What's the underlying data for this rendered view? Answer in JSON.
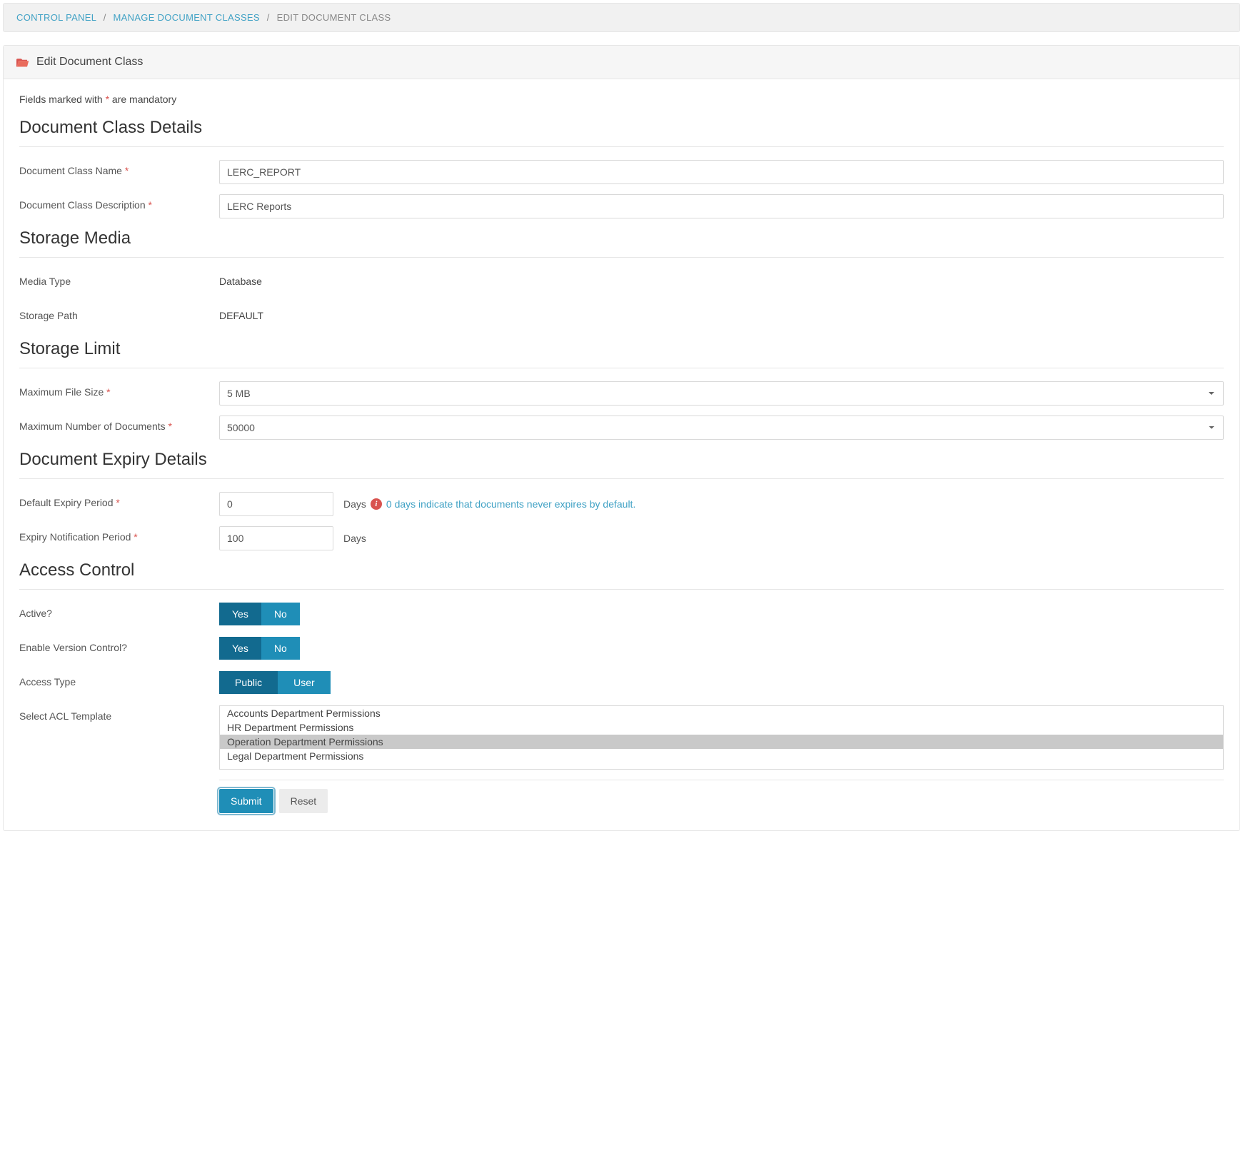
{
  "breadcrumb": {
    "items": [
      {
        "label": "CONTROL PANEL"
      },
      {
        "label": "MANAGE DOCUMENT CLASSES"
      }
    ],
    "current": "EDIT DOCUMENT CLASS"
  },
  "panel": {
    "title": "Edit Document Class"
  },
  "mandatory_note_prefix": "Fields marked with ",
  "mandatory_note_suffix": " are mandatory",
  "asterisk": "*",
  "sections": {
    "details": "Document Class Details",
    "storage_media": "Storage Media",
    "storage_limit": "Storage Limit",
    "expiry": "Document Expiry Details",
    "access": "Access Control"
  },
  "labels": {
    "class_name": "Document Class Name",
    "class_desc": "Document Class Description",
    "media_type": "Media Type",
    "storage_path": "Storage Path",
    "max_file_size": "Maximum File Size",
    "max_docs": "Maximum Number of Documents",
    "default_expiry": "Default Expiry Period",
    "expiry_notif": "Expiry Notification Period",
    "active": "Active?",
    "version_control": "Enable Version Control?",
    "access_type": "Access Type",
    "acl_template": "Select ACL Template"
  },
  "values": {
    "class_name": "LERC_REPORT",
    "class_desc": "LERC Reports",
    "media_type": "Database",
    "storage_path": "DEFAULT",
    "max_file_size": "5 MB",
    "max_docs": "50000",
    "default_expiry": "0",
    "expiry_notif": "100"
  },
  "hints": {
    "days": "Days",
    "expiry_zero": "0 days indicate that documents never expires by default."
  },
  "toggles": {
    "yes": "Yes",
    "no": "No",
    "public": "Public",
    "user": "User",
    "active_selected": "Yes",
    "version_selected": "Yes",
    "access_selected": "Public"
  },
  "acl": {
    "options": [
      "Accounts Department Permissions",
      "HR Department Permissions",
      "Operation Department Permissions",
      "Legal Department Permissions"
    ],
    "selected_index": 2
  },
  "buttons": {
    "submit": "Submit",
    "reset": "Reset"
  }
}
